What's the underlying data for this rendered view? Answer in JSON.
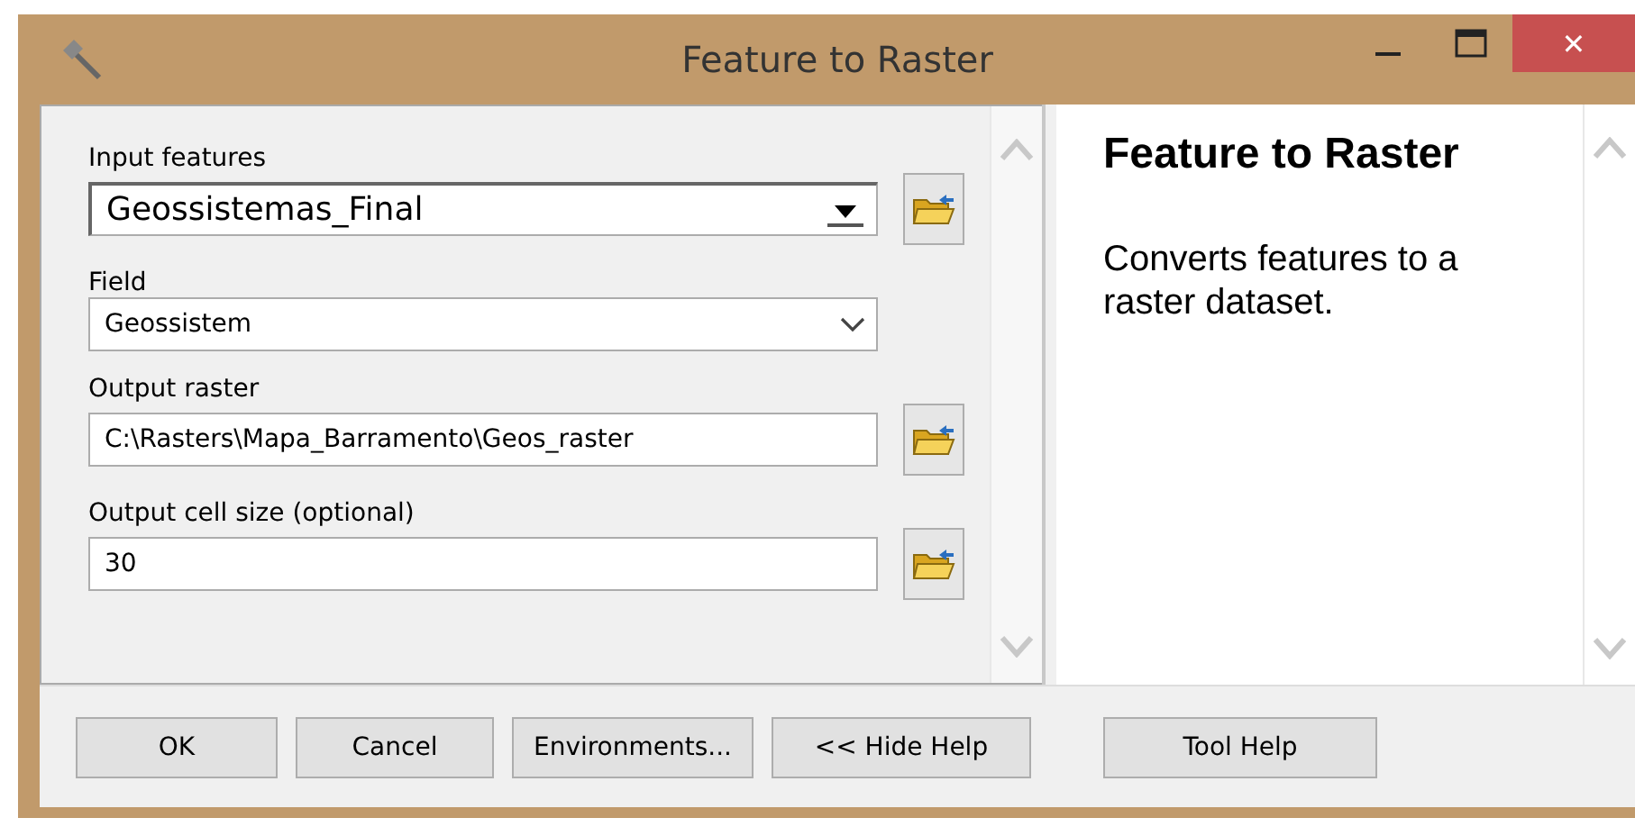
{
  "window": {
    "title": "Feature to Raster",
    "close_glyph": "✕"
  },
  "parameters": [
    {
      "label": "Input features",
      "kind": "combo",
      "value": "Geossistemas_Final",
      "browse": true
    },
    {
      "label": "Field",
      "kind": "select",
      "value": "Geossistem",
      "browse": false
    },
    {
      "label": "Output raster",
      "kind": "text",
      "value": "C:\\Rasters\\Mapa_Barramento\\Geos_raster",
      "browse": true
    },
    {
      "label": "Output cell size (optional)",
      "kind": "text",
      "value": "30",
      "browse": true
    }
  ],
  "help": {
    "title": "Feature to Raster",
    "text": "Converts features to a raster dataset."
  },
  "buttons": [
    "OK",
    "Cancel",
    "Environments...",
    "<< Hide Help",
    "Tool Help"
  ]
}
